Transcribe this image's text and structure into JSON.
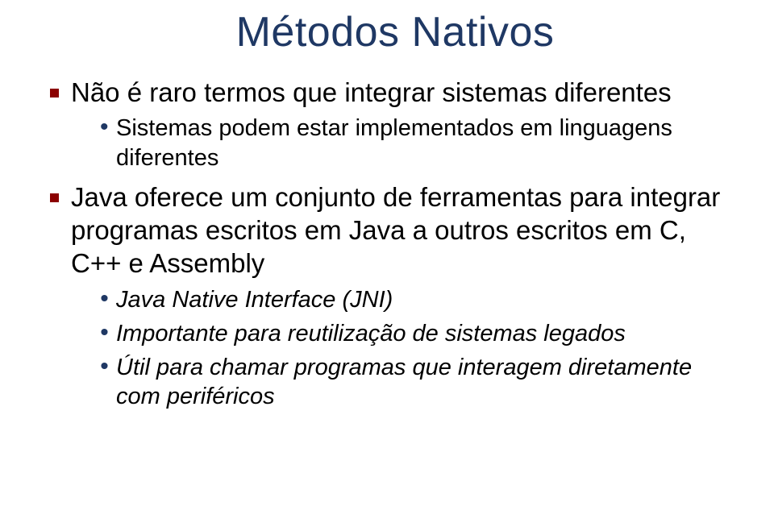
{
  "title": "Métodos Nativos",
  "bullets": {
    "b1": {
      "text": "Não é raro termos que integrar sistemas diferentes",
      "sub1": "Sistemas podem estar implementados em linguagens diferentes"
    },
    "b2": {
      "text": "Java oferece um conjunto de ferramentas para integrar programas escritos em Java a outros escritos em C, C++ e Assembly",
      "sub1": "Java Native Interface (JNI)",
      "sub2": "Importante para reutilização de sistemas legados",
      "sub3": "Útil para chamar programas que interagem diretamente com periféricos"
    }
  }
}
